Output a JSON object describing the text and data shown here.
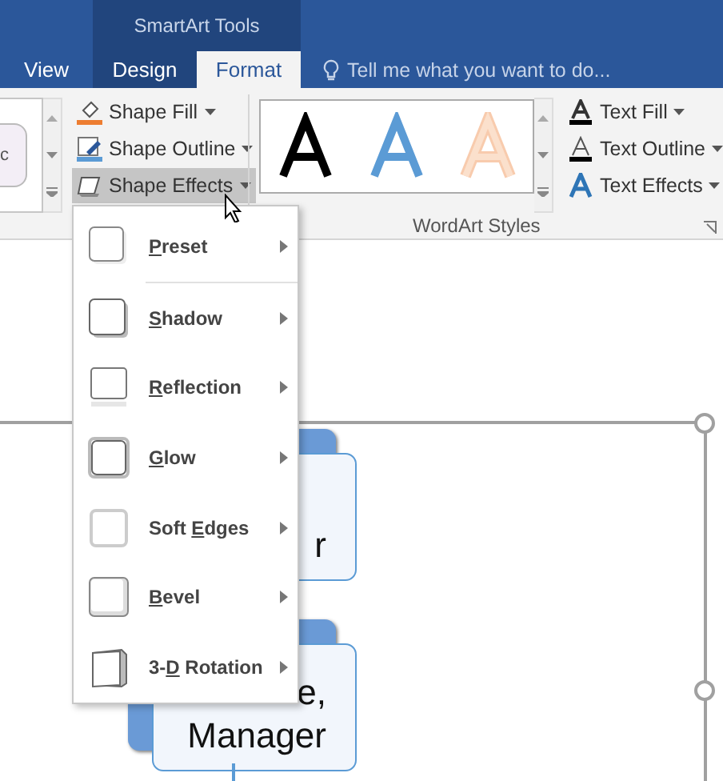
{
  "title_bar": {
    "context_label": "SmartArt Tools"
  },
  "tabs": [
    {
      "label": "View",
      "selected": false,
      "contextual": false
    },
    {
      "label": "Design",
      "selected": false,
      "contextual": true
    },
    {
      "label": "Format",
      "selected": true,
      "contextual": true
    }
  ],
  "tell_me": {
    "placeholder": "Tell me what you want to do..."
  },
  "ribbon": {
    "shape_gallery_fragment": "c",
    "shape_buttons": [
      {
        "kind": "fill",
        "label": "Shape Fill",
        "pressed": false
      },
      {
        "kind": "outline",
        "label": "Shape Outline",
        "pressed": false
      },
      {
        "kind": "effects",
        "label": "Shape Effects",
        "pressed": true
      }
    ],
    "wordart_styles": [
      {
        "kind": "black"
      },
      {
        "kind": "blue"
      },
      {
        "kind": "orange"
      }
    ],
    "text_buttons": [
      {
        "kind": "fill",
        "label": "Text Fill"
      },
      {
        "kind": "outline",
        "label": "Text Outline"
      },
      {
        "kind": "effects",
        "label": "Text Effects"
      }
    ],
    "group_label": "WordArt Styles"
  },
  "menu": {
    "items": [
      {
        "kind": "preset",
        "label": {
          "access_key": "P",
          "after": "reset"
        }
      },
      {
        "kind": "shadow",
        "label": {
          "access_key": "S",
          "after": "hadow"
        }
      },
      {
        "kind": "reflection",
        "label": {
          "access_key": "R",
          "after": "eflection"
        }
      },
      {
        "kind": "glow",
        "label": {
          "access_key": "G",
          "after": "low"
        }
      },
      {
        "kind": "soft",
        "label": {
          "before": "Soft ",
          "access_key": "E",
          "after": "dges"
        }
      },
      {
        "kind": "bevel",
        "label": {
          "access_key": "B",
          "after": "evel"
        }
      },
      {
        "kind": "rotation",
        "label": {
          "before": "3-",
          "access_key": "D",
          "after": " Rotation"
        }
      }
    ]
  },
  "smartart": {
    "shapes": [
      {
        "lines": [
          "r"
        ]
      },
      {
        "lines": [
          "e,",
          "Manager"
        ]
      }
    ]
  }
}
